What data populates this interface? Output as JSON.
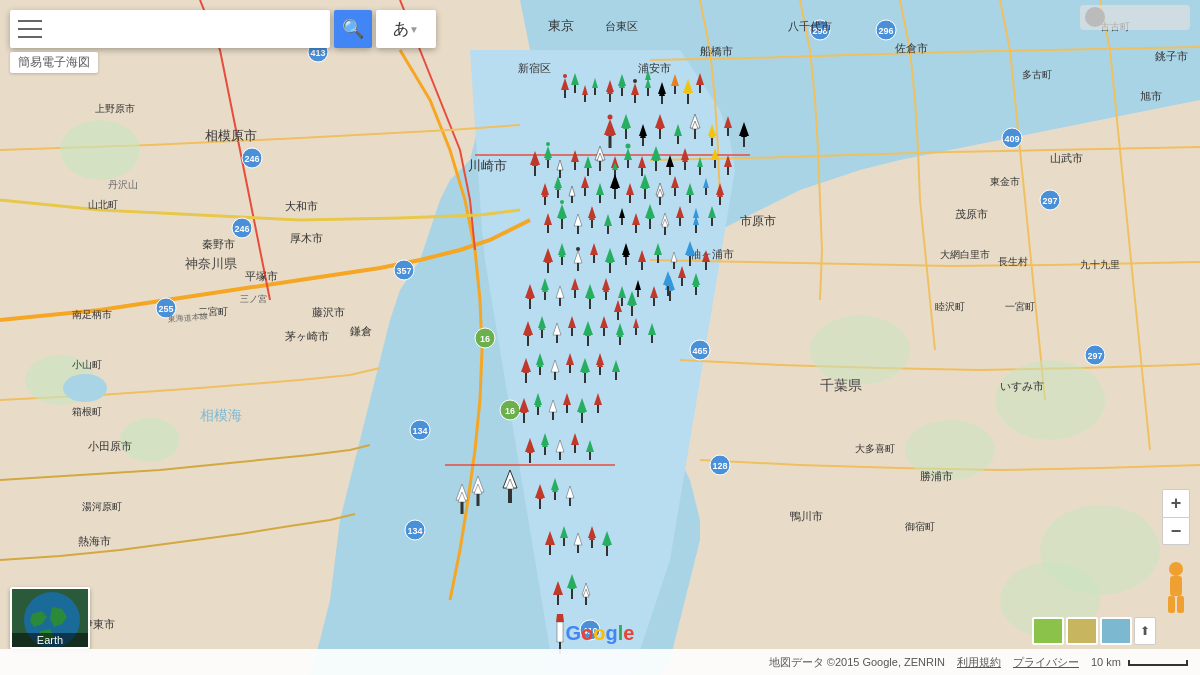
{
  "header": {
    "search_placeholder": "",
    "search_label": "簡易電子海図",
    "input_mode": "あ",
    "input_mode_dropdown": "▼"
  },
  "map": {
    "center": "Tokyo Bay, Japan",
    "attribution": "地図データ ©2015 Google, ZENRIN",
    "terms": "利用規約",
    "privacy": "プライバシー",
    "scale_label": "10 km",
    "google_logo": "Google"
  },
  "controls": {
    "zoom_in": "+",
    "zoom_out": "−",
    "hamburger_lines": 3,
    "expand_icon": "⬆",
    "compass_title": "compass"
  },
  "earth_thumbnail": {
    "label": "Earth"
  },
  "map_layers": [
    {
      "id": "default",
      "color": "#f5e6c8"
    },
    {
      "id": "satellite",
      "color": "#2d5a1b"
    },
    {
      "id": "terrain",
      "color": "#e8d5a3"
    }
  ],
  "buoys": {
    "description": "Maritime buoy markers in Tokyo Bay area - navigation aids"
  }
}
